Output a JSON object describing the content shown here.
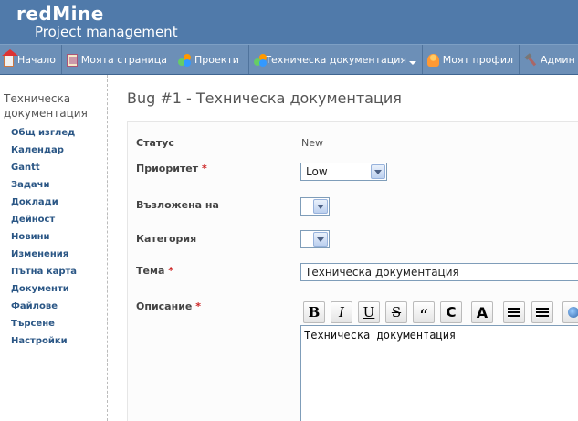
{
  "header": {
    "brand": "redMine",
    "subtitle": "Project management"
  },
  "menu": {
    "items": [
      {
        "label": "Начало",
        "icon": "home-icon"
      },
      {
        "label": "Моята страница",
        "icon": "my-page-icon"
      },
      {
        "label": "Проекти",
        "icon": "projects-icon"
      },
      {
        "label": "Техническа документация",
        "icon": "projects-icon"
      },
      {
        "label": "Моят профил",
        "icon": "user-icon"
      },
      {
        "label": "Админ",
        "icon": "admin-icon"
      }
    ]
  },
  "sidebar": {
    "project_title": "Техническа документация",
    "items": [
      "Общ изглед",
      "Календар",
      "Gantt",
      "Задачи",
      "Доклади",
      "Дейност",
      "Новини",
      "Изменения",
      "Пътна карта",
      "Документи",
      "Файлове",
      "Търсене",
      "Настройки"
    ]
  },
  "issue": {
    "title": "Bug #1 - Техническа документация",
    "status_label": "Статус",
    "status_value": "New",
    "priority_label": "Приоритет",
    "priority_value": "Low",
    "assigned_label": "Възложена на",
    "assigned_value": "",
    "category_label": "Категория",
    "category_value": "",
    "subject_label": "Тема",
    "subject_value": "Техническа документация",
    "description_label": "Описание",
    "description_value": "Техническа документация",
    "required_mark": "*"
  },
  "toolbar": {
    "bold": "B",
    "italic": "I",
    "underline": "U",
    "strike": "S",
    "quote": "“",
    "code": "C",
    "heading": "A"
  }
}
